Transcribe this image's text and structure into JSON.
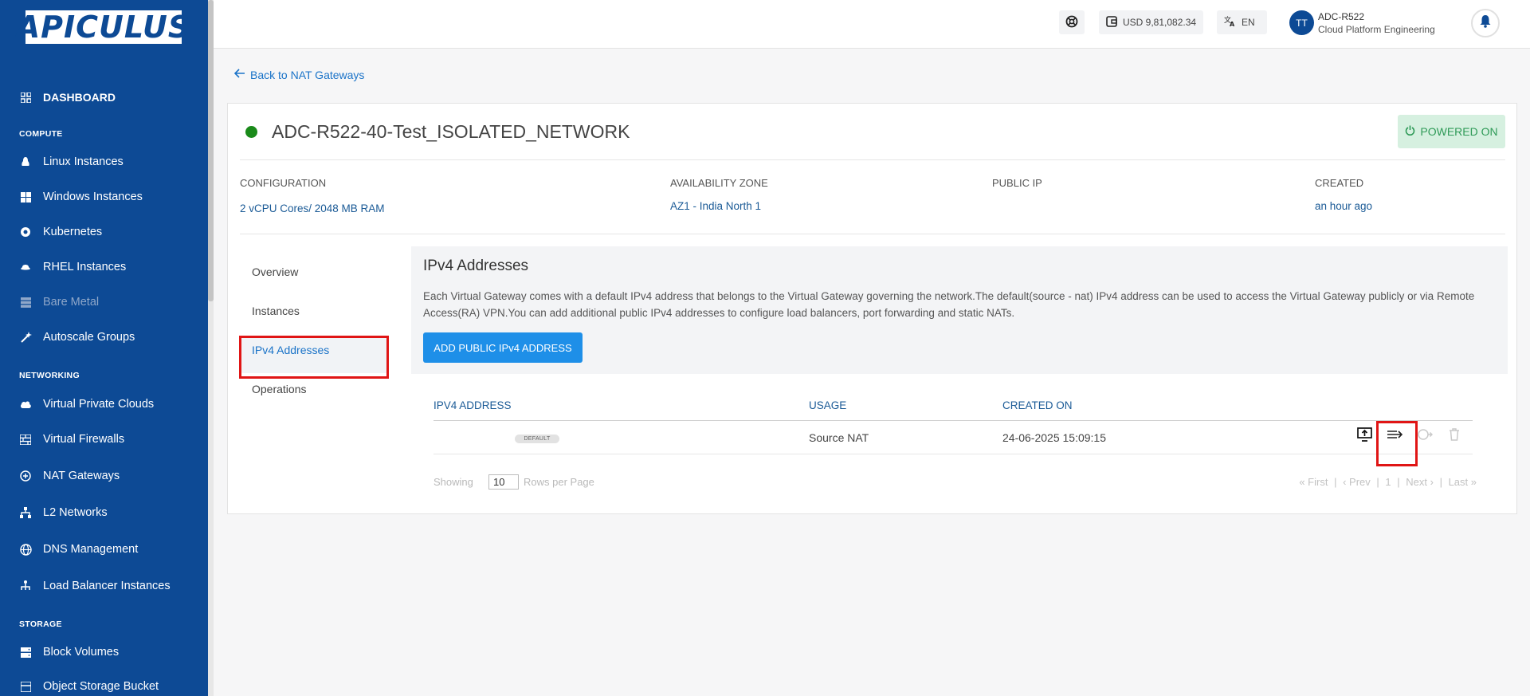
{
  "brand": {
    "logo_text": "APICULUS"
  },
  "sidebar": {
    "dashboard": "DASHBOARD",
    "sections": {
      "compute": "COMPUTE",
      "networking": "NETWORKING",
      "storage": "STORAGE"
    },
    "items": [
      {
        "label": "Linux Instances",
        "icon": "linux-icon"
      },
      {
        "label": "Windows Instances",
        "icon": "windows-icon"
      },
      {
        "label": "Kubernetes",
        "icon": "kubernetes-icon"
      },
      {
        "label": "RHEL Instances",
        "icon": "rhel-icon"
      },
      {
        "label": "Bare Metal",
        "icon": "server-icon"
      },
      {
        "label": "Autoscale Groups",
        "icon": "magic-wand-icon"
      },
      {
        "label": "Virtual Private Clouds",
        "icon": "cloud-icon"
      },
      {
        "label": "Virtual Firewalls",
        "icon": "firewall-icon"
      },
      {
        "label": "NAT Gateways",
        "icon": "nat-icon"
      },
      {
        "label": "L2 Networks",
        "icon": "network-icon"
      },
      {
        "label": "DNS Management",
        "icon": "globe-icon"
      },
      {
        "label": "Load Balancer Instances",
        "icon": "load-balancer-icon"
      },
      {
        "label": "Block Volumes",
        "icon": "storage-icon"
      },
      {
        "label": "Object Storage Bucket",
        "icon": "bucket-icon"
      }
    ]
  },
  "header": {
    "balance": "USD 9,81,082.34",
    "language": "EN",
    "avatar_initials": "TT",
    "user_name": "ADC-R522",
    "user_org": "Cloud Platform Engineering"
  },
  "main": {
    "back_link": "Back to NAT Gateways",
    "title": "ADC-R522-40-Test_ISOLATED_NETWORK",
    "status": "POWERED ON",
    "info": {
      "configuration_label": "CONFIGURATION",
      "configuration_value": "2 vCPU Cores/ 2048 MB RAM",
      "zone_label": "AVAILABILITY ZONE",
      "zone_value": "AZ1 - India North 1",
      "public_ip_label": "PUBLIC IP",
      "created_label": "CREATED",
      "created_value": "an hour ago"
    },
    "tabs": [
      "Overview",
      "Instances",
      "IPv4 Addresses",
      "Operations"
    ],
    "panel": {
      "title": "IPv4 Addresses",
      "description": "Each Virtual Gateway comes with a default IPv4 address that belongs to the Virtual Gateway governing the network.The default(source - nat) IPv4 address can be used to access the Virtual Gateway publicly or via Remote Access(RA) VPN.You can add additional public IPv4 addresses to configure load balancers, port forwarding and static NATs.",
      "add_button": "ADD PUBLIC IPv4 ADDRESS"
    },
    "table": {
      "columns": [
        "IPV4 ADDRESS",
        "USAGE",
        "CREATED ON"
      ],
      "rows": [
        {
          "badge": "DEFAULT",
          "usage": "Source NAT",
          "created_on": "24-06-2025 15:09:15"
        }
      ]
    },
    "pager": {
      "showing": "Showing",
      "rows_per_page_value": "10",
      "rows_per_page": "Rows per Page",
      "first": "« First",
      "prev": "‹ Prev",
      "page": "1",
      "next": "Next ›",
      "last": "Last »",
      "sep": "|"
    }
  }
}
